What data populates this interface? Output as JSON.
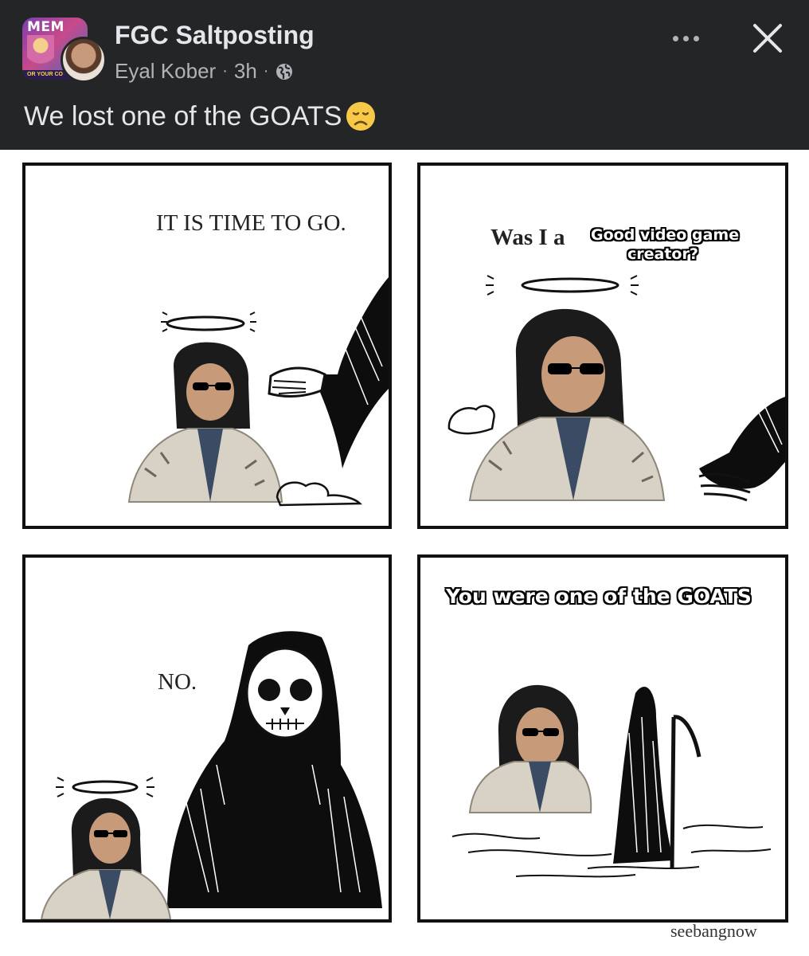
{
  "post": {
    "group_name": "FGC Saltposting",
    "author": "Eyal Kober",
    "time_ago": "3h",
    "separator": "·",
    "caption": "We lost one of the GOATS",
    "group_avatar": {
      "brand_text": "MEM",
      "footer_text": "OR YOUR CO"
    },
    "icons": {
      "privacy": "globe-icon",
      "more": "more-icon",
      "close": "close-icon",
      "emoji": "sad-emoji-icon"
    },
    "colors": {
      "header_bg": "#242526",
      "primary_text": "#e4e6eb",
      "secondary_text": "#b0b3b8",
      "emoji": "#f7c948"
    }
  },
  "comic": {
    "panel1": {
      "caption": "IT IS TIME TO GO."
    },
    "panel2": {
      "caption": "Was I a",
      "meme_line1": "Good video game",
      "meme_line2": "creator?"
    },
    "panel3": {
      "caption": "NO."
    },
    "panel4": {
      "meme_text": "You were one of the GOATS"
    },
    "signature": "seebangnow"
  }
}
